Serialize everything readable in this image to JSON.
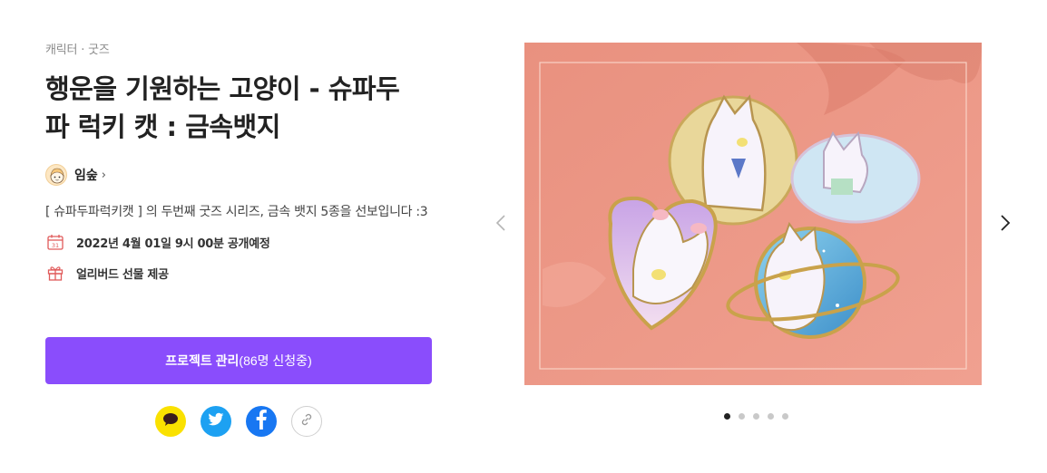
{
  "project": {
    "category": "캐릭터 · 굿즈",
    "title": "행운을 기원하는 고양이 - 슈파두파 럭키 캣 : 금속뱃지",
    "creator": {
      "name": "임숲",
      "chevron": "›"
    },
    "description": "[ 슈파두파럭키캣 ] 의 두번째 굿즈 시리즈, 금속 뱃지 5종을 선보입니다 :3",
    "launch": {
      "icon": "calendar-icon",
      "calendar_day": "31",
      "text": "2022년 4월 01일 9시 00분 공개예정"
    },
    "gift": {
      "icon": "gift-icon",
      "text": "얼리버드 선물 제공"
    },
    "cta": {
      "label": "프로젝트 관리",
      "sub": "(86명 신청중)",
      "color": "#8a4dfc"
    }
  },
  "share": [
    {
      "name": "share-kakao-button",
      "icon": "kakao-talk-icon",
      "color": "#fae100"
    },
    {
      "name": "share-twitter-button",
      "icon": "twitter-icon",
      "color": "#1da1f2"
    },
    {
      "name": "share-facebook-button",
      "icon": "facebook-icon",
      "color": "#1877f2"
    },
    {
      "name": "share-link-button",
      "icon": "link-icon",
      "color": "#ffffff"
    }
  ],
  "carousel": {
    "image": "metal-cat-badges-photo",
    "total_slides": 5,
    "active_slide": 1,
    "prev_icon": "chevron-left-icon",
    "next_icon": "chevron-right-icon"
  }
}
